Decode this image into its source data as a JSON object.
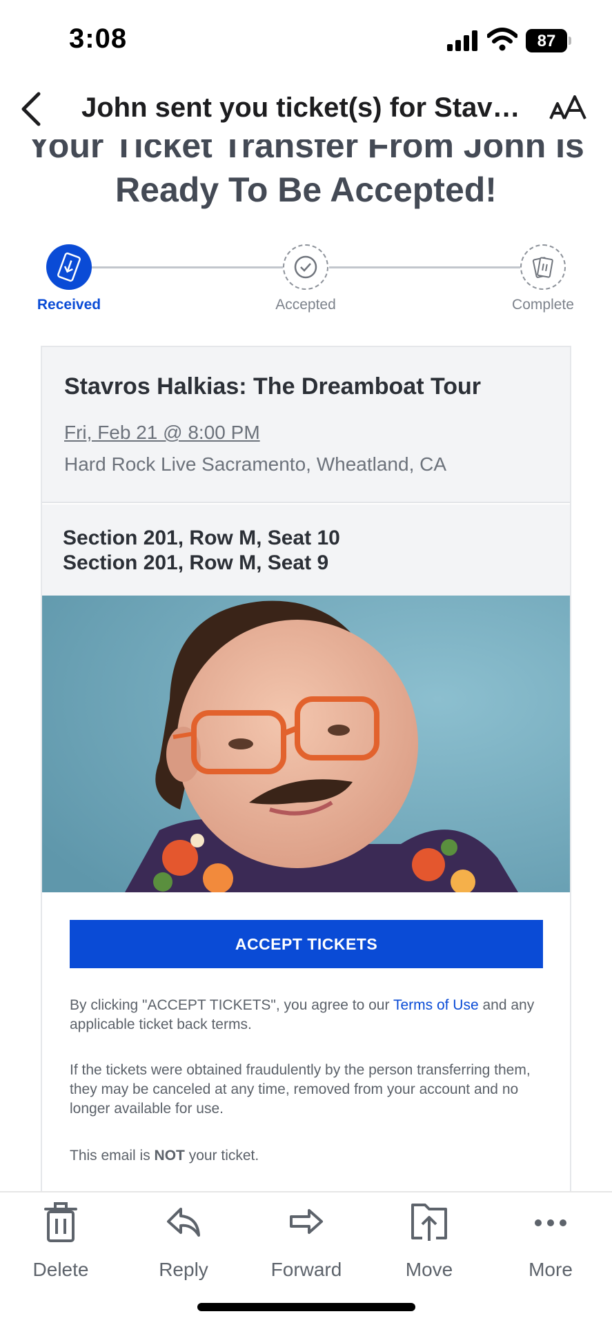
{
  "status_bar": {
    "time": "3:08",
    "battery": "87"
  },
  "nav": {
    "title": "John sent you ticket(s) for Stavr..."
  },
  "email": {
    "headline_line1": "Your Ticket Transfer From John Is",
    "headline_line2": "Ready To Be Accepted!",
    "steps": [
      {
        "label": "Received",
        "state": "active"
      },
      {
        "label": "Accepted",
        "state": "pending"
      },
      {
        "label": "Complete",
        "state": "pending"
      }
    ],
    "event": {
      "title": "Stavros Halkias: The Dreamboat Tour",
      "date": "Fri, Feb 21 @ 8:00 PM",
      "venue": "Hard Rock Live Sacramento, Wheatland, CA"
    },
    "seats": [
      "Section 201, Row M, Seat 10",
      "Section 201, Row M, Seat 9"
    ],
    "accept_button": "ACCEPT TICKETS",
    "legal": {
      "agree_prefix": "By clicking \"ACCEPT TICKETS\", you agree to our ",
      "terms_link": "Terms of Use",
      "agree_suffix": " and any applicable ticket back terms.",
      "fraud": "If the tickets were obtained fraudulently by the person transferring them, they may be canceled at any time, removed from your account and no longer available for use.",
      "not_ticket_prefix": "This email is ",
      "not_ticket_bold": "NOT",
      "not_ticket_suffix": " your ticket."
    },
    "colors": {
      "accent": "#0a4bd6",
      "photo_background": "#6ea3b6"
    }
  },
  "toolbar": {
    "items": [
      {
        "label": "Delete",
        "icon": "trash-icon"
      },
      {
        "label": "Reply",
        "icon": "reply-icon"
      },
      {
        "label": "Forward",
        "icon": "forward-icon"
      },
      {
        "label": "Move",
        "icon": "move-icon"
      },
      {
        "label": "More",
        "icon": "more-icon"
      }
    ]
  }
}
